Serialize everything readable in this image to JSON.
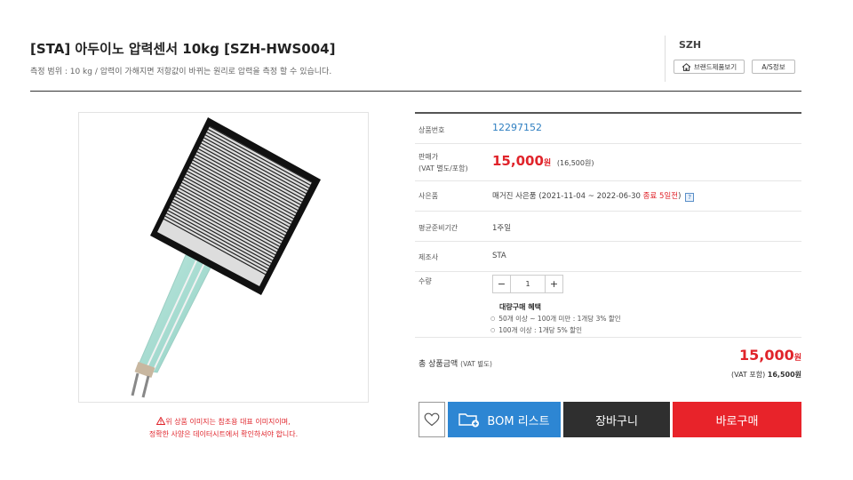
{
  "product": {
    "title": "[STA] 아두이노 압력센서 10kg [SZH-HWS004]",
    "subtitle": "측정 범위 : 10 kg / 압력이 가해지면 저항값이 바뀌는 원리로 압력을 측정 할 수 있습니다."
  },
  "brand": {
    "name": "SZH",
    "brand_products_label": "브랜드제품보기",
    "as_info_label": "A/S정보"
  },
  "image_notice": {
    "line1": "위 상품 이미지는 참조용 대표 이미지이며,",
    "line2": "정확한 사양은 데이터시트에서 확인하셔야 합니다."
  },
  "info": {
    "code_label": "상품번호",
    "code_value": "12297152",
    "price_label_1": "판매가",
    "price_label_2": "(VAT 별도/포함)",
    "price_value": "15,000",
    "price_won": "원",
    "price_vat": "(16,500원)",
    "gift_label": "사은품",
    "gift_value": "매거진 사은품 (2021-11-04 ~ 2022-06-30",
    "gift_end": "종료 5일전",
    "gift_close": ")",
    "gift_help": "?",
    "lead_label": "평균준비기간",
    "lead_value": "1주일",
    "maker_label": "제조사",
    "maker_value": "STA",
    "qty_label": "수량",
    "qty_minus": "−",
    "qty_value": "1",
    "qty_plus": "+",
    "bulk_title": "대량구매 혜택",
    "bulk_items": [
      "50개 이상 ~ 100개 미만 : 1개당 3% 할인",
      "100개 이상 : 1개당 5% 할인"
    ]
  },
  "total": {
    "label": "총 상품금액",
    "label_small": "(VAT 별도)",
    "value": "15,000",
    "won": "원",
    "vat_label": "(VAT 포함)",
    "vat_value": "16,500원"
  },
  "buttons": {
    "bom": "BOM 리스트",
    "cart": "장바구니",
    "buy": "바로구매"
  },
  "colors": {
    "accent_red": "#e8232a",
    "bom_blue": "#2d86d3",
    "cart_dark": "#2f2f2f",
    "link_blue": "#2f7fc1"
  },
  "icons": {
    "home": "home-icon",
    "warning": "warning-icon",
    "wishlist": "heart-icon",
    "bom": "folder-add-icon"
  }
}
